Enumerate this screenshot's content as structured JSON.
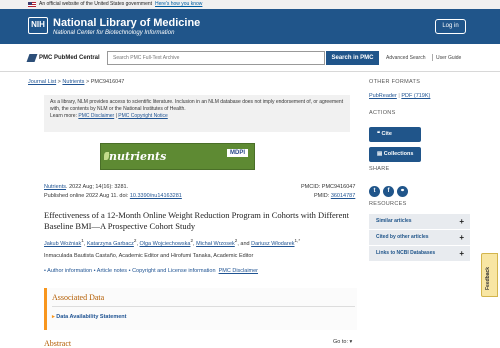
{
  "gov_banner": {
    "text": "An official website of the United States government",
    "link": "Here's how you know"
  },
  "header": {
    "logo": "NIH",
    "title": "National Library of Medicine",
    "subtitle": "National Center for Biotechnology Information",
    "login": "Log in"
  },
  "search": {
    "logo": "PMC PubMed Central",
    "placeholder": "Search PMC Full-Text Archive",
    "button": "Search in PMC",
    "advanced": "Advanced Search",
    "user_guide": "User Guide"
  },
  "breadcrumb": {
    "journal_list": "Journal List",
    "sep1": ">",
    "journal": "Nutrients",
    "sep2": ">",
    "current": "PMC9416047"
  },
  "notice": {
    "text": "As a library, NLM provides access to scientific literature. Inclusion in an NLM database does not imply endorsement of, or agreement with, the contents by NLM or the National Institutes of Health.",
    "learn_more": "Learn more:",
    "disclaimer": "PMC Disclaimer",
    "sep": "|",
    "copyright": "PMC Copyright Notice"
  },
  "banner": {
    "brand": "nutrients",
    "publisher": "MDPI"
  },
  "article": {
    "journal": "Nutrients",
    "citation": ". 2022 Aug; 14(16): 3281.",
    "published": "Published online 2022 Aug 11. doi:",
    "doi": "10.3390/nu14163281",
    "pmcid": "PMCID: PMC9416047",
    "pmid_label": "PMID:",
    "pmid": "36014787",
    "title": "Effectiveness of a 12-Month Online Weight Reduction Program in Cohorts with Different Baseline BMI—A Prospective Cohort Study",
    "authors": [
      {
        "name": "Jakub Woźniak",
        "sup": "1"
      },
      {
        "name": "Katarzyna Garbacz",
        "sup": "2"
      },
      {
        "name": "Olga Wojciechowska",
        "sup": "2"
      },
      {
        "name": "Michał Wrzosek",
        "sup": "2"
      },
      {
        "name": "Dariusz Włodarek",
        "sup": "1,*"
      }
    ],
    "and": "and",
    "editors": "Inmaculada Bautista Castaño, Academic Editor and Hirofumi Tanaka, Academic Editor",
    "info_links": [
      "Author information",
      "Article notes",
      "Copyright and License information",
      "PMC Disclaimer"
    ]
  },
  "associated": {
    "heading": "Associated Data",
    "item": "Data Availability Statement"
  },
  "abstract": {
    "heading": "Abstract",
    "goto": "Go to:"
  },
  "sidebar": {
    "other_formats": "OTHER FORMATS",
    "pubreader": "PubReader",
    "pdf": "PDF (719K)",
    "actions": "ACTIONS",
    "cite": "Cite",
    "collections": "Collections",
    "share": "SHARE",
    "resources": "RESOURCES",
    "resource_items": [
      "Similar articles",
      "Cited by other articles",
      "Links to NCBI Databases"
    ]
  },
  "feedback": "Feedback",
  "colors": {
    "header_blue": "#20558a",
    "link_blue": "#205493",
    "accent_orange": "#f8961d"
  }
}
